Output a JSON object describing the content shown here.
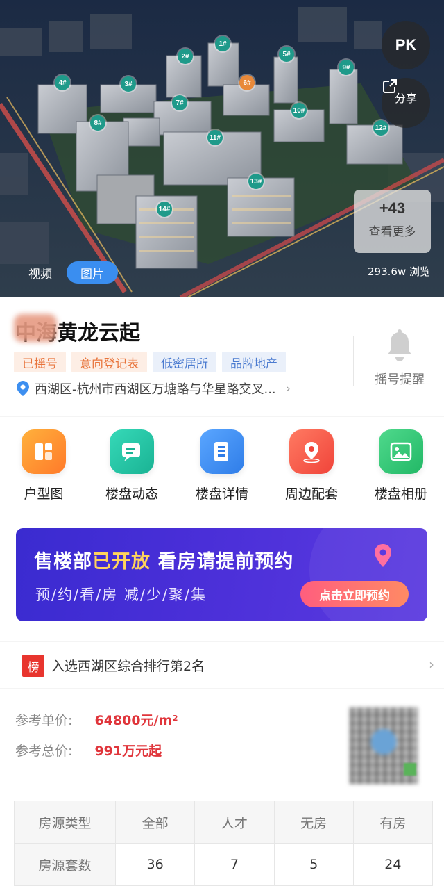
{
  "hero": {
    "pk_label": "PK",
    "share_label": "分享",
    "more_count": "+43",
    "more_label": "查看更多",
    "views": "293.6w 浏览",
    "tabs": [
      "视频",
      "图片"
    ],
    "active_tab": "图片",
    "building_labels": [
      "1#",
      "2#",
      "3#",
      "4#",
      "5#",
      "6#",
      "7#",
      "8#",
      "9#",
      "10#",
      "11#",
      "12#",
      "13#",
      "14#"
    ]
  },
  "info": {
    "title": "中海黄龙云起",
    "tags": [
      {
        "text": "已摇号",
        "color": "orange"
      },
      {
        "text": "意向登记表",
        "color": "orange"
      },
      {
        "text": "低密居所",
        "color": "blue"
      },
      {
        "text": "品牌地产",
        "color": "blue"
      }
    ],
    "address": "西湖区-杭州市西湖区万塘路与华星路交叉...",
    "remind_label": "摇号提醒"
  },
  "quick_nav": [
    {
      "label": "户型图",
      "icon": "floorplan-icon",
      "color": "#ff8a30"
    },
    {
      "label": "楼盘动态",
      "icon": "chat-news-icon",
      "color": "#22c4a8"
    },
    {
      "label": "楼盘详情",
      "icon": "document-icon",
      "color": "#3d8ff0"
    },
    {
      "label": "周边配套",
      "icon": "location-pin-icon",
      "color": "#ff5a4a"
    },
    {
      "label": "楼盘相册",
      "icon": "photo-album-icon",
      "color": "#2fc07a"
    }
  ],
  "banner": {
    "line1_a": "售楼部",
    "line1_highlight": "已开放",
    "line1_b": "看房请提前预约",
    "line2": "预/约/看/房 减/少/聚/集",
    "cta": "点击立即预约"
  },
  "rank": {
    "badge": "榜",
    "text": "入选西湖区综合排行第2名"
  },
  "price": {
    "unit_label": "参考单价:",
    "unit_value": "64800元/m²",
    "total_label": "参考总价:",
    "total_value": "991万元起"
  },
  "source_table": {
    "header": [
      "房源类型",
      "全部",
      "人才",
      "无房",
      "有房"
    ],
    "row_label": "房源套数",
    "counts": [
      "36",
      "7",
      "5",
      "24"
    ]
  }
}
